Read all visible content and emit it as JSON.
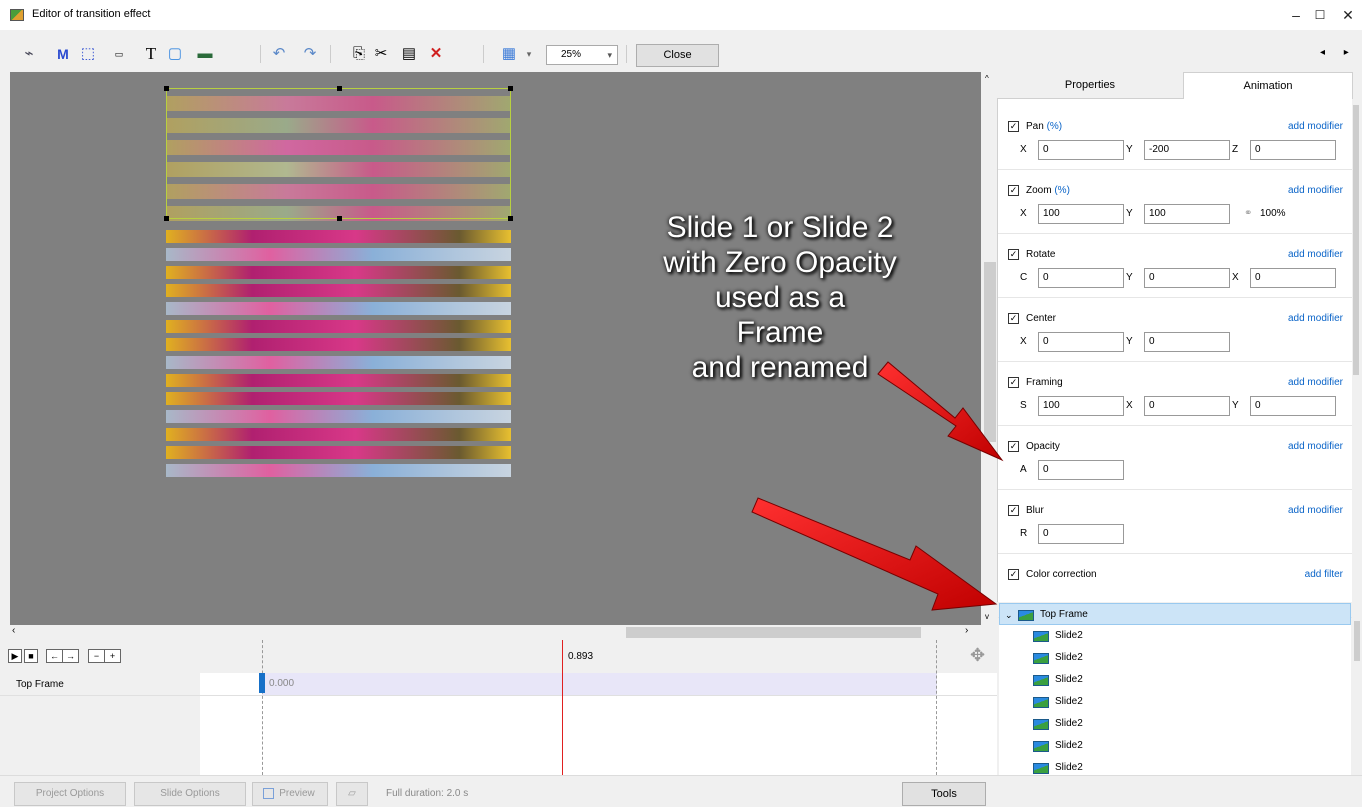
{
  "window": {
    "title": "Editor of transition effect",
    "minimize": "–",
    "maximize": "☐",
    "close": "✕"
  },
  "toolbar": {
    "zoom": "25%",
    "close_label": "Close",
    "nav": "◂ ▸"
  },
  "callout": {
    "lines": [
      "Slide 1 or Slide 2",
      "with Zero Opacity",
      "used as a",
      "Frame",
      "and renamed"
    ]
  },
  "panel": {
    "tabs": [
      "Properties",
      "Animation"
    ],
    "active_tab": "Animation",
    "sections": [
      {
        "name": "Pan",
        "unit": "(%)",
        "link": "add modifier",
        "fields": [
          {
            "label": "X",
            "value": "0"
          },
          {
            "label": "Y",
            "value": "-200"
          },
          {
            "label": "Z",
            "value": "0"
          }
        ]
      },
      {
        "name": "Zoom",
        "unit": "(%)",
        "link": "add modifier",
        "fields": [
          {
            "label": "X",
            "value": "100"
          },
          {
            "label": "Y",
            "value": "100"
          }
        ],
        "extra": "100%"
      },
      {
        "name": "Rotate",
        "unit": "",
        "link": "add modifier",
        "fields": [
          {
            "label": "C",
            "value": "0"
          },
          {
            "label": "Y",
            "value": "0"
          },
          {
            "label": "X",
            "value": "0"
          }
        ]
      },
      {
        "name": "Center",
        "unit": "",
        "link": "add modifier",
        "fields": [
          {
            "label": "X",
            "value": "0"
          },
          {
            "label": "Y",
            "value": "0"
          }
        ]
      },
      {
        "name": "Framing",
        "unit": "",
        "link": "add modifier",
        "fields": [
          {
            "label": "S",
            "value": "100"
          },
          {
            "label": "X",
            "value": "0"
          },
          {
            "label": "Y",
            "value": "0"
          }
        ]
      },
      {
        "name": "Opacity",
        "unit": "",
        "link": "add modifier",
        "fields": [
          {
            "label": "A",
            "value": "0"
          }
        ]
      },
      {
        "name": "Blur",
        "unit": "",
        "link": "add modifier",
        "fields": [
          {
            "label": "R",
            "value": "0"
          }
        ]
      },
      {
        "name": "Color correction",
        "unit": "",
        "link": "add filter",
        "fields": []
      }
    ]
  },
  "tree": {
    "root": "Top Frame",
    "children": [
      "Slide2",
      "Slide2",
      "Slide2",
      "Slide2",
      "Slide2",
      "Slide2",
      "Slide2"
    ]
  },
  "timeline": {
    "current_time": "0.893",
    "track_label": "Top Frame",
    "keyframe_value": "0.000",
    "controls": [
      "▶",
      "■",
      "←",
      "→",
      "−",
      "+"
    ]
  },
  "statusbar": {
    "project_options": "Project Options",
    "slide_options": "Slide Options",
    "preview": "Preview",
    "duration": "Full duration: 2.0 s",
    "tools": "Tools"
  }
}
